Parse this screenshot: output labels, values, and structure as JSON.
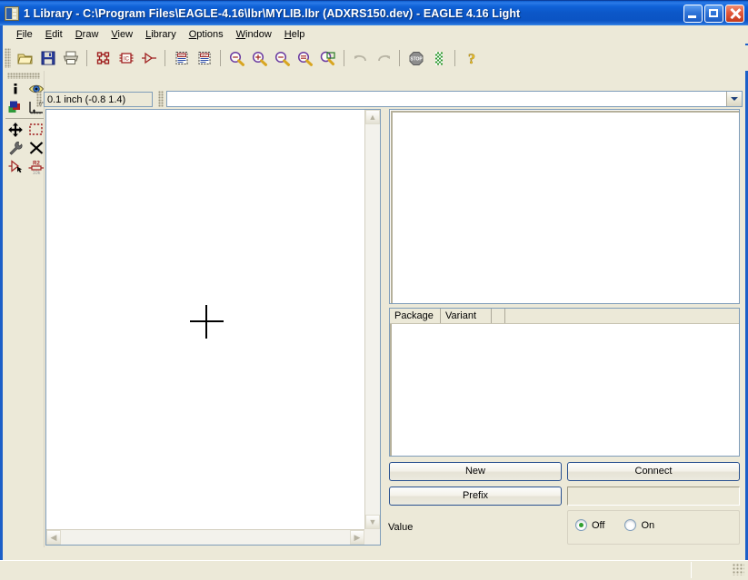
{
  "window": {
    "title": "1 Library - C:\\Program Files\\EAGLE-4.16\\lbr\\MYLIB.lbr (ADXRS150.dev) - EAGLE 4.16 Light",
    "icon": "library-document-icon",
    "minimize_label": "Minimize",
    "maximize_label": "Maximize",
    "close_label": "Close",
    "accent_color": "#0b54c4",
    "face_color": "#ece9d8"
  },
  "menubar": {
    "items": [
      {
        "label": "File",
        "accel": "F"
      },
      {
        "label": "Edit",
        "accel": "E"
      },
      {
        "label": "Draw",
        "accel": "D"
      },
      {
        "label": "View",
        "accel": "V"
      },
      {
        "label": "Library",
        "accel": "L"
      },
      {
        "label": "Options",
        "accel": "O"
      },
      {
        "label": "Window",
        "accel": "W"
      },
      {
        "label": "Help",
        "accel": "H"
      }
    ]
  },
  "toolbar": {
    "buttons": [
      {
        "name": "open-icon",
        "label": "Open"
      },
      {
        "name": "save-icon",
        "label": "Save"
      },
      {
        "name": "print-icon",
        "label": "Print"
      },
      {
        "name": "board-icon",
        "label": "Board"
      },
      {
        "name": "package-icon",
        "label": "Package"
      },
      {
        "name": "symbol-icon",
        "label": "Symbol"
      },
      {
        "name": "script-icon",
        "label": "SCR"
      },
      {
        "name": "ulp-icon",
        "label": "ULP"
      },
      {
        "name": "zoom-fit-icon",
        "label": "Zoom to fit"
      },
      {
        "name": "zoom-in-icon",
        "label": "Zoom in"
      },
      {
        "name": "zoom-out-icon",
        "label": "Zoom out"
      },
      {
        "name": "zoom-redraw-icon",
        "label": "Redraw"
      },
      {
        "name": "zoom-select-icon",
        "label": "Zoom select"
      },
      {
        "name": "undo-icon",
        "label": "Undo"
      },
      {
        "name": "redo-icon",
        "label": "Redo"
      },
      {
        "name": "stop-icon",
        "label": "Stop"
      },
      {
        "name": "go-icon",
        "label": "Go"
      },
      {
        "name": "help-icon",
        "label": "Help"
      }
    ]
  },
  "tool_palette": {
    "buttons": [
      {
        "name": "info-icon",
        "label": "Info"
      },
      {
        "name": "display-icon",
        "label": "Display"
      },
      {
        "name": "layer-icon",
        "label": "Layer"
      },
      {
        "name": "grid-icon",
        "label": "Grid"
      },
      {
        "name": "move-icon",
        "label": "Move"
      },
      {
        "name": "group-icon",
        "label": "Group"
      },
      {
        "name": "change-icon",
        "label": "Change"
      },
      {
        "name": "delete-icon",
        "label": "Delete"
      },
      {
        "name": "pinswap-icon",
        "label": "Pinswap"
      },
      {
        "name": "name-icon",
        "label": "Name"
      }
    ]
  },
  "coordbar": {
    "coordinates": "0.1 inch (-0.8 1.4)",
    "command_value": "",
    "command_placeholder": ""
  },
  "canvas": {
    "origin_marker": "crosshair",
    "background": "#ffffff"
  },
  "device_panel": {
    "gates_list_items": [],
    "package_table": {
      "columns": [
        "Package",
        "Variant",
        "",
        ""
      ],
      "rows": []
    },
    "buttons": {
      "new": "New",
      "connect": "Connect",
      "prefix": "Prefix"
    },
    "prefix_value": "",
    "value_setting": {
      "label": "Value",
      "options": [
        "Off",
        "On"
      ],
      "selected": "Off",
      "selected_color": "#30a030"
    }
  },
  "scrollbars": {
    "vertical": {
      "up": "▲",
      "down": "▼"
    },
    "horizontal": {
      "left": "◀",
      "right": "▶"
    }
  }
}
